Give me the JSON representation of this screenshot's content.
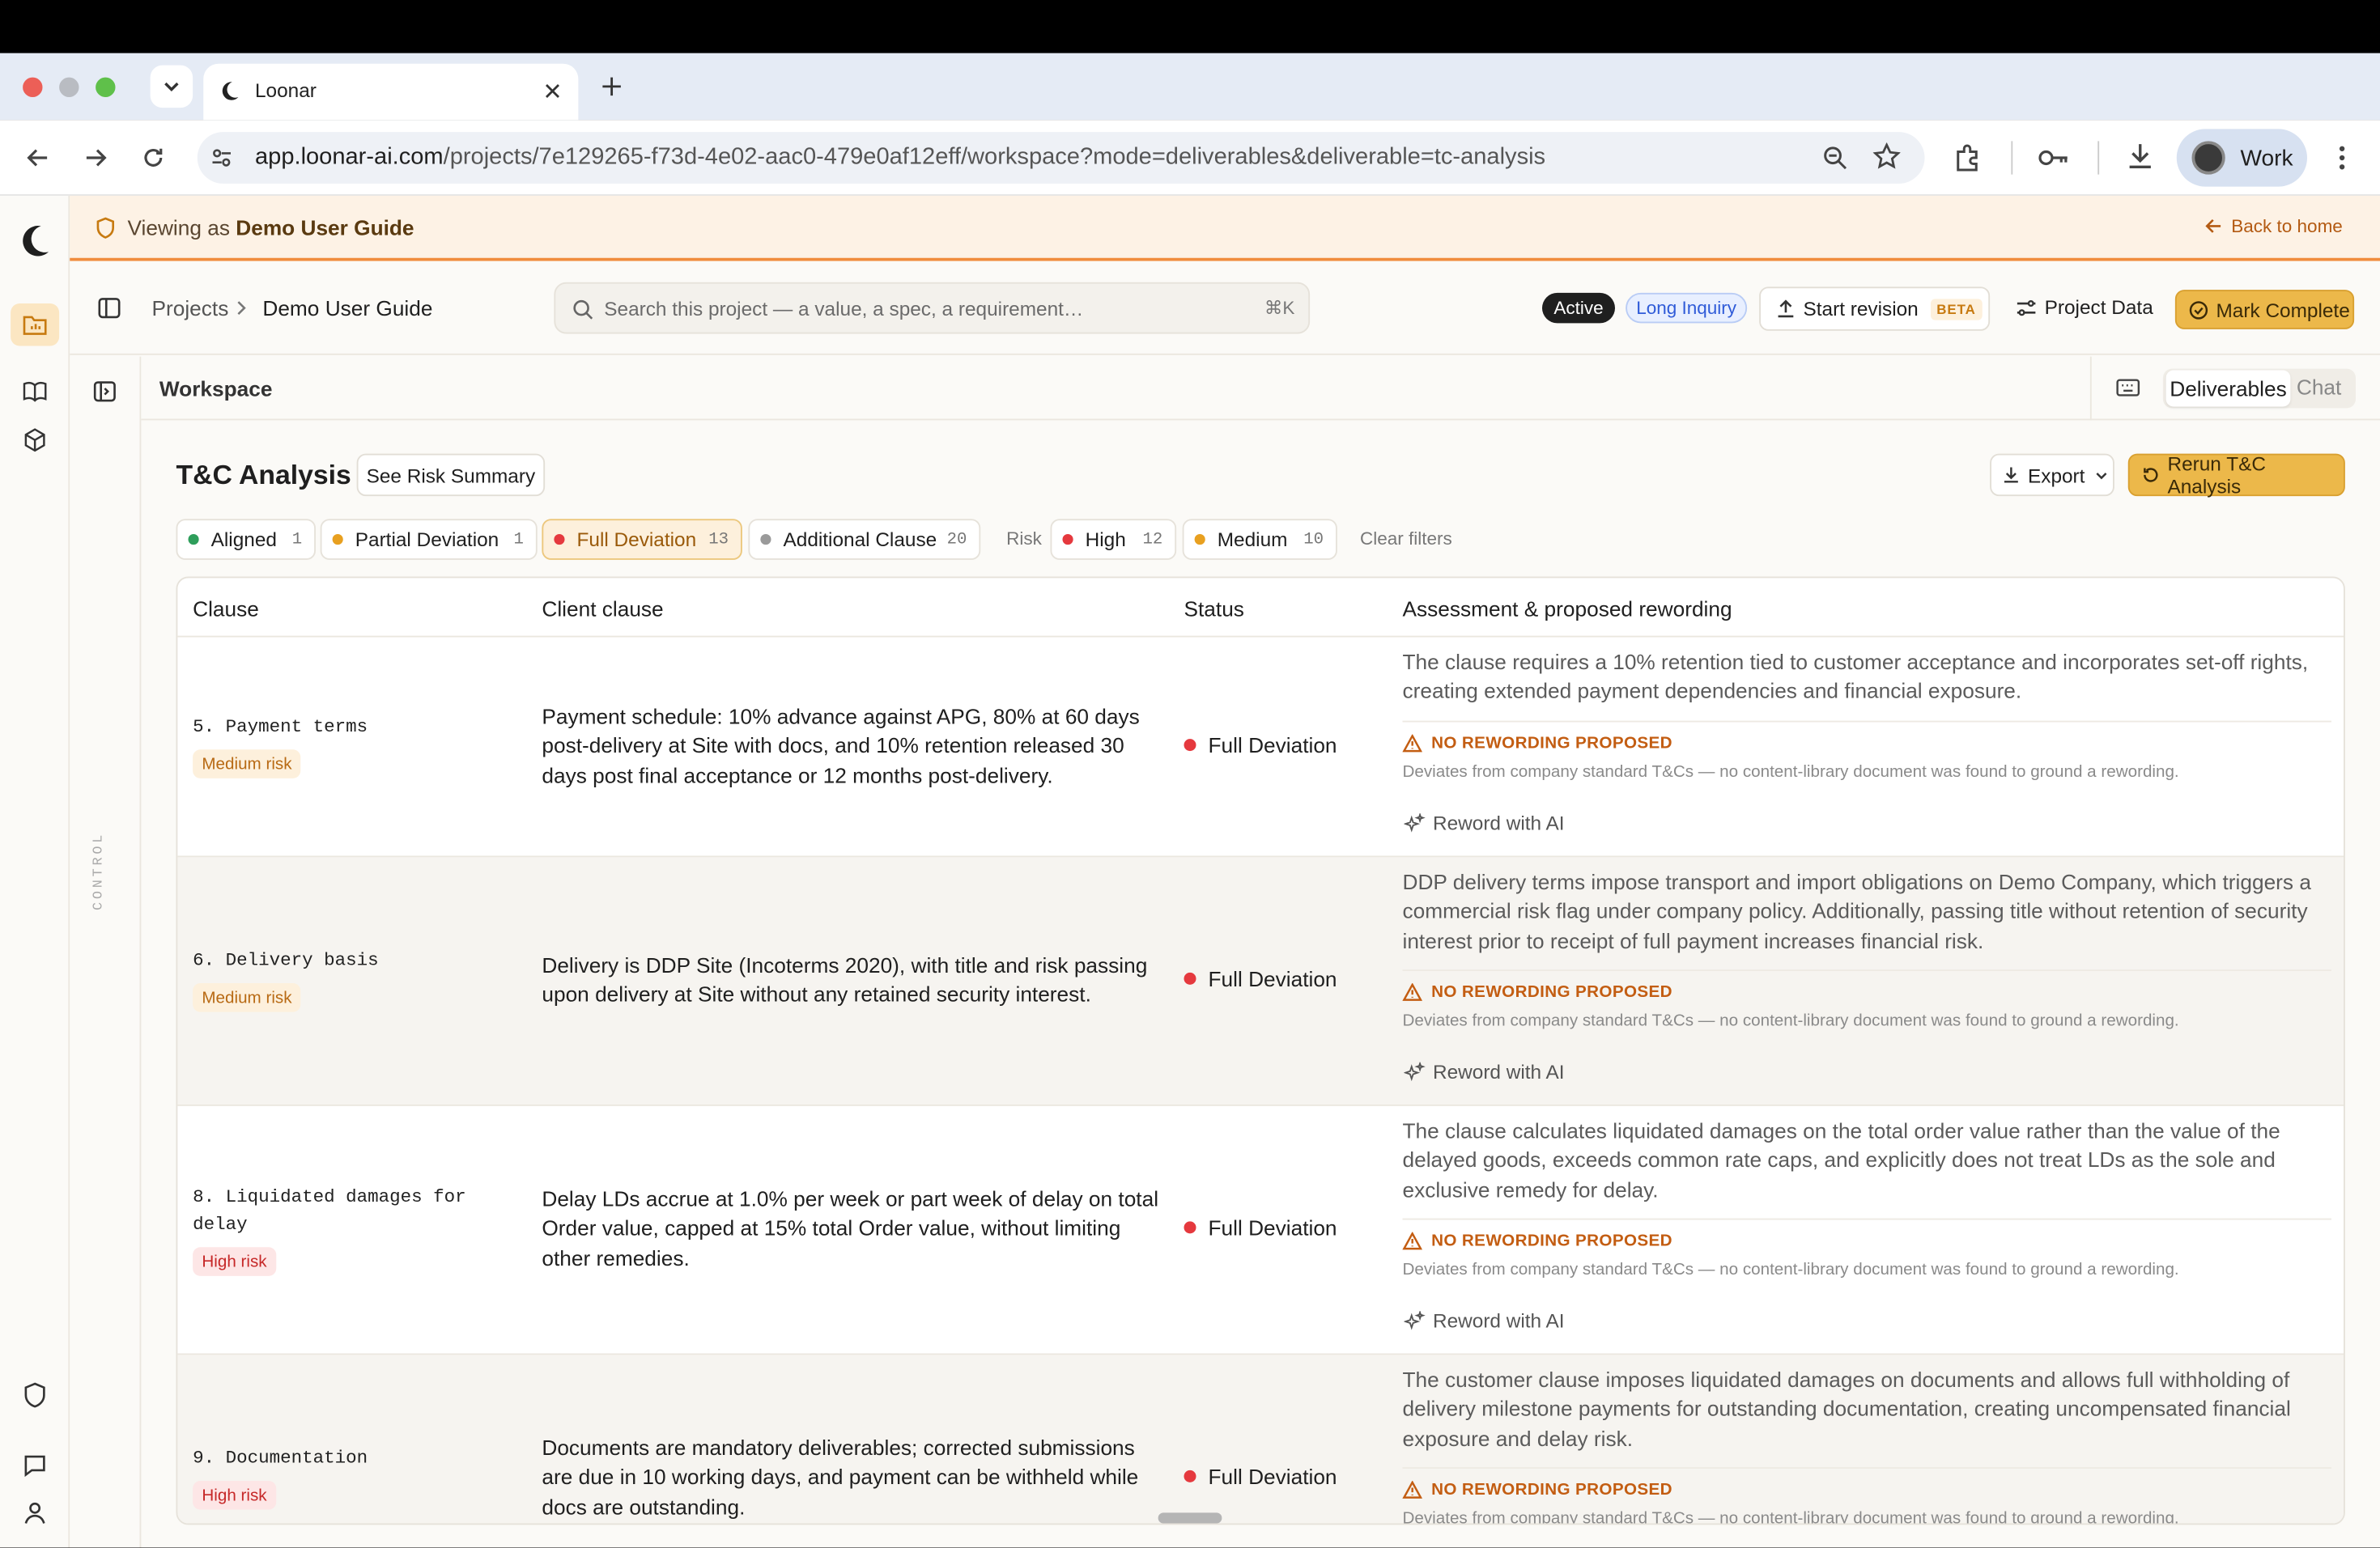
{
  "browser": {
    "tab_title": "Loonar",
    "url_host": "app.loonar-ai.com",
    "url_path": "/projects/7e129265-f73d-4e02-aac0-479e0af12eff/workspace?mode=deliverables&deliverable=tc-analysis",
    "profile": "Work"
  },
  "banner": {
    "prefix": "Viewing as",
    "user": "Demo User Guide",
    "back": "Back to home"
  },
  "header": {
    "breadcrumb_root": "Projects",
    "breadcrumb_current": "Demo User Guide",
    "search_placeholder": "Search this project — a value, a spec, a requirement…",
    "search_shortcut": "⌘K",
    "status_badge": "Active",
    "inquiry_badge": "Long Inquiry",
    "start_revision": "Start revision",
    "beta": "BETA",
    "project_data": "Project Data",
    "mark_complete": "Mark Complete"
  },
  "control_label": "CONTROL",
  "workspace": {
    "title": "Workspace",
    "tab_deliverables": "Deliverables",
    "tab_chat": "Chat"
  },
  "analysis": {
    "title": "T&C Analysis",
    "risk_summary": "See Risk Summary",
    "export": "Export",
    "rerun": "Rerun T&C Analysis"
  },
  "filters": {
    "status": [
      {
        "label": "Aligned",
        "count": "1",
        "color": "#2e9e5b"
      },
      {
        "label": "Partial Deviation",
        "count": "1",
        "color": "#e8a020"
      },
      {
        "label": "Full Deviation",
        "count": "13",
        "color": "#e5393e"
      },
      {
        "label": "Additional Clause",
        "count": "20",
        "color": "#9a9a9a"
      }
    ],
    "risk_label": "Risk",
    "risk": [
      {
        "label": "High",
        "count": "12",
        "color": "#e5393e"
      },
      {
        "label": "Medium",
        "count": "10",
        "color": "#e8a020"
      }
    ],
    "clear": "Clear filters"
  },
  "table": {
    "headers": [
      "Clause",
      "Client clause",
      "Status",
      "Assessment & proposed rewording"
    ],
    "no_reword_label": "NO REWORDING PROPOSED",
    "no_reword_desc": "Deviates from company standard T&Cs — no content-library document was found to ground a rewording.",
    "reword_button": "Reword with AI",
    "rows": [
      {
        "clause_line1": "5. Payment terms",
        "clause_line2": "",
        "risk": "Medium risk",
        "client_clause": "Payment schedule: 10% advance against APG, 80% at 60 days post-delivery at Site with docs, and 10% retention released 30 days post final acceptance or 12 months post-delivery.",
        "status": "Full Deviation",
        "assessment": "The clause requires a 10% retention tied to customer acceptance and incorporates set-off rights, creating extended payment dependencies and financial exposure."
      },
      {
        "clause_line1": "6. Delivery basis",
        "clause_line2": "",
        "risk": "Medium risk",
        "client_clause": "Delivery is DDP Site (Incoterms 2020), with title and risk passing upon delivery at Site without any retained security interest.",
        "status": "Full Deviation",
        "assessment": "DDP delivery terms impose transport and import obligations on Demo Company, which triggers a commercial risk flag under company policy. Additionally, passing title without retention of security interest prior to receipt of full payment increases financial risk."
      },
      {
        "clause_line1": "8. Liquidated damages for",
        "clause_line2": "delay",
        "risk": "High risk",
        "client_clause": "Delay LDs accrue at 1.0% per week or part week of delay on total Order value, capped at 15% total Order value, without limiting other remedies.",
        "status": "Full Deviation",
        "assessment": "The clause calculates liquidated damages on the total order value rather than the value of the delayed goods, exceeds common rate caps, and explicitly does not treat LDs as the sole and exclusive remedy for delay."
      },
      {
        "clause_line1": "9. Documentation",
        "clause_line2": "",
        "risk": "High risk",
        "client_clause": "Documents are mandatory deliverables; corrected submissions are due in 10 working days, and payment can be withheld while docs are outstanding.",
        "status": "Full Deviation",
        "assessment": "The customer clause imposes liquidated damages on documents and allows full withholding of delivery milestone payments for outstanding documentation, creating uncompensated financial exposure and delay risk."
      }
    ]
  }
}
